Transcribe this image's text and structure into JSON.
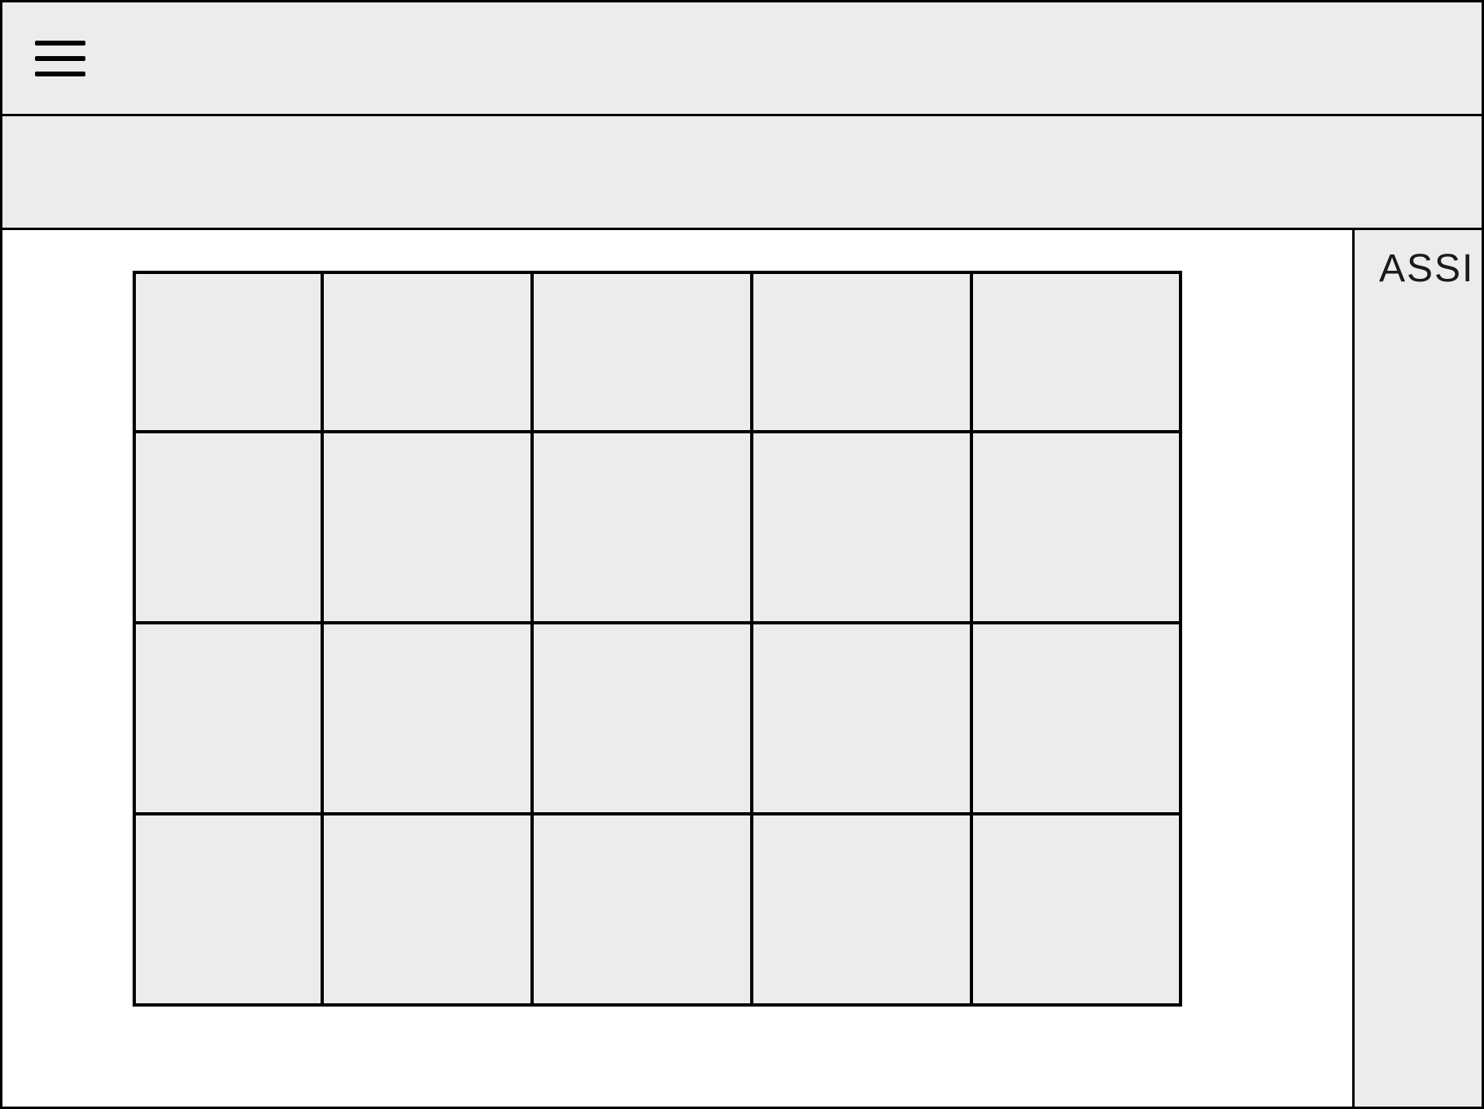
{
  "header": {
    "menu_icon": "hamburger-menu"
  },
  "subheader": {},
  "grid": {
    "rows": 4,
    "cols": 5,
    "cells": [
      [
        "",
        "",
        "",
        "",
        ""
      ],
      [
        "",
        "",
        "",
        "",
        ""
      ],
      [
        "",
        "",
        "",
        "",
        ""
      ],
      [
        "",
        "",
        "",
        "",
        ""
      ]
    ]
  },
  "sidebar": {
    "title": "ASSI"
  }
}
